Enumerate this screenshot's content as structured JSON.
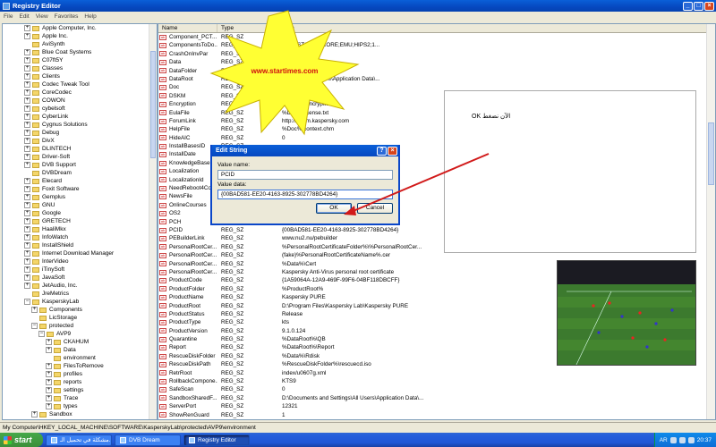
{
  "window": {
    "title": "Registry Editor"
  },
  "menu": [
    "File",
    "Edit",
    "View",
    "Favorites",
    "Help"
  ],
  "tree": [
    {
      "label": "Apple Computer, Inc.",
      "depth": 2,
      "exp": "+"
    },
    {
      "label": "Apple Inc.",
      "depth": 2,
      "exp": "+"
    },
    {
      "label": "AviSynth",
      "depth": 2,
      "exp": ""
    },
    {
      "label": "Blue Coat Systems",
      "depth": 2,
      "exp": "+"
    },
    {
      "label": "C07ft5Y",
      "depth": 2,
      "exp": "+"
    },
    {
      "label": "Classes",
      "depth": 2,
      "exp": "+"
    },
    {
      "label": "Clients",
      "depth": 2,
      "exp": "+"
    },
    {
      "label": "Codec Tweak Tool",
      "depth": 2,
      "exp": "+"
    },
    {
      "label": "CoreCodec",
      "depth": 2,
      "exp": "+"
    },
    {
      "label": "COWON",
      "depth": 2,
      "exp": "+"
    },
    {
      "label": "cybelsoft",
      "depth": 2,
      "exp": "+"
    },
    {
      "label": "CyberLink",
      "depth": 2,
      "exp": "+"
    },
    {
      "label": "Cygnus Solutions",
      "depth": 2,
      "exp": "+"
    },
    {
      "label": "Debug",
      "depth": 2,
      "exp": "+"
    },
    {
      "label": "DivX",
      "depth": 2,
      "exp": "+"
    },
    {
      "label": "DLINTECH",
      "depth": 2,
      "exp": "+"
    },
    {
      "label": "Driver-Soft",
      "depth": 2,
      "exp": "+"
    },
    {
      "label": "DVB Support",
      "depth": 2,
      "exp": "+"
    },
    {
      "label": "DVBDream",
      "depth": 2,
      "exp": ""
    },
    {
      "label": "Elecard",
      "depth": 2,
      "exp": "+"
    },
    {
      "label": "Foxit Software",
      "depth": 2,
      "exp": "+"
    },
    {
      "label": "Gemplus",
      "depth": 2,
      "exp": "+"
    },
    {
      "label": "GNU",
      "depth": 2,
      "exp": "+"
    },
    {
      "label": "Google",
      "depth": 2,
      "exp": "+"
    },
    {
      "label": "GRETECH",
      "depth": 2,
      "exp": "+"
    },
    {
      "label": "HaaliMkx",
      "depth": 2,
      "exp": "+"
    },
    {
      "label": "InfoWatch",
      "depth": 2,
      "exp": "+"
    },
    {
      "label": "InstallShield",
      "depth": 2,
      "exp": "+"
    },
    {
      "label": "Internet Download Manager",
      "depth": 2,
      "exp": "+"
    },
    {
      "label": "InterVideo",
      "depth": 2,
      "exp": "+"
    },
    {
      "label": "iTinySoft",
      "depth": 2,
      "exp": "+"
    },
    {
      "label": "JavaSoft",
      "depth": 2,
      "exp": "+"
    },
    {
      "label": "JetAudio, Inc.",
      "depth": 2,
      "exp": "+"
    },
    {
      "label": "JreMetrics",
      "depth": 2,
      "exp": ""
    },
    {
      "label": "KasperskyLab",
      "depth": 2,
      "exp": "-"
    },
    {
      "label": "Components",
      "depth": 3,
      "exp": "+"
    },
    {
      "label": "LicStorage",
      "depth": 3,
      "exp": ""
    },
    {
      "label": "protected",
      "depth": 3,
      "exp": "-"
    },
    {
      "label": "AVP9",
      "depth": 4,
      "exp": "-"
    },
    {
      "label": "CKAHUM",
      "depth": 5,
      "exp": "+"
    },
    {
      "label": "Data",
      "depth": 5,
      "exp": "+"
    },
    {
      "label": "environment",
      "depth": 5,
      "exp": ""
    },
    {
      "label": "FilesToRemove",
      "depth": 5,
      "exp": "+"
    },
    {
      "label": "profiles",
      "depth": 5,
      "exp": "+"
    },
    {
      "label": "reports",
      "depth": 5,
      "exp": "+"
    },
    {
      "label": "settings",
      "depth": 5,
      "exp": "+"
    },
    {
      "label": "Trace",
      "depth": 5,
      "exp": "+"
    },
    {
      "label": "types",
      "depth": 5,
      "exp": "+"
    },
    {
      "label": "Sandbox",
      "depth": 3,
      "exp": "+"
    },
    {
      "label": "SetupFolders",
      "depth": 3,
      "exp": ""
    }
  ],
  "list": {
    "headers": [
      "Name",
      "Type",
      "Data"
    ],
    "rows": [
      {
        "name": "Component_PCT...",
        "type": "REG_SZ",
        "data": "1"
      },
      {
        "name": "ComponentsToDo...",
        "type": "REG_SZ",
        "data": "AV;BLST2;BSS;CORE;EMU;HIPS2;1..."
      },
      {
        "name": "CrashOnInvPar",
        "type": "REG_SZ",
        "data": ""
      },
      {
        "name": "Data",
        "type": "REG_SZ",
        "data": ""
      },
      {
        "name": "DataFolder",
        "type": "REG_SZ",
        "data": ""
      },
      {
        "name": "DataRoot",
        "type": "REG_SZ",
        "data": "...Settings\\All Users\\Application Data\\..."
      },
      {
        "name": "Doc",
        "type": "REG_SZ",
        "data": ""
      },
      {
        "name": "DSKM",
        "type": "REG_SZ",
        "data": "%Data%\\dskm"
      },
      {
        "name": "Encryption",
        "type": "REG_SZ",
        "data": "%Data%\\Encryption"
      },
      {
        "name": "EulaFile",
        "type": "REG_SZ",
        "data": "%Doc%\\license.txt"
      },
      {
        "name": "ForumLink",
        "type": "REG_SZ",
        "data": "http://forum.kaspersky.com"
      },
      {
        "name": "HelpFile",
        "type": "REG_SZ",
        "data": "%Doc%\\context.chm"
      },
      {
        "name": "HideAIC",
        "type": "REG_SZ",
        "data": "0"
      },
      {
        "name": "InstallBasesID",
        "type": "REG_SZ",
        "data": ""
      },
      {
        "name": "InstallDate",
        "type": "REG_SZ",
        "data": ""
      },
      {
        "name": "KnowledgeBaseL...",
        "type": "REG_SZ",
        "data": ""
      },
      {
        "name": "Localization",
        "type": "REG_SZ",
        "data": ""
      },
      {
        "name": "LocalizationId",
        "type": "REG_SZ",
        "data": ""
      },
      {
        "name": "NeedReboot4Co...",
        "type": "REG_SZ",
        "data": ""
      },
      {
        "name": "NewsFile",
        "type": "REG_SZ",
        "data": ""
      },
      {
        "name": "OnlineCourses",
        "type": "REG_SZ",
        "data": "...ses"
      },
      {
        "name": "OS2",
        "type": "REG_SZ",
        "data": ""
      },
      {
        "name": "PCH",
        "type": "REG_SZ",
        "data": ""
      },
      {
        "name": "PCID",
        "type": "REG_SZ",
        "data": "{00BAD581-EE20-4163-8925-302778BD4264}"
      },
      {
        "name": "PEBuilderLink",
        "type": "REG_SZ",
        "data": "www.nu2.nu/pebuilder"
      },
      {
        "name": "PersonalRootCer...",
        "type": "REG_SZ",
        "data": "%PersonalRootCertificateFolder%\\%PersonalRootCer..."
      },
      {
        "name": "PersonalRootCer...",
        "type": "REG_SZ",
        "data": "(fake)%PersonalRootCertificateName%.cer"
      },
      {
        "name": "PersonalRootCer...",
        "type": "REG_SZ",
        "data": "%Data%\\Cert"
      },
      {
        "name": "PersonalRootCer...",
        "type": "REG_SZ",
        "data": "Kaspersky Anti-Virus personal root certificate"
      },
      {
        "name": "ProductCode",
        "type": "REG_SZ",
        "data": "{1A59064A-12A9-469F-99F6-04BF118DBCFF}"
      },
      {
        "name": "ProductFolder",
        "type": "REG_SZ",
        "data": "%ProductRoot%"
      },
      {
        "name": "ProductName",
        "type": "REG_SZ",
        "data": "Kaspersky PURE"
      },
      {
        "name": "ProductRoot",
        "type": "REG_SZ",
        "data": "D:\\Program Files\\Kaspersky Lab\\Kaspersky PURE"
      },
      {
        "name": "ProductStatus",
        "type": "REG_SZ",
        "data": "Release"
      },
      {
        "name": "ProductType",
        "type": "REG_SZ",
        "data": "kts"
      },
      {
        "name": "ProductVersion",
        "type": "REG_SZ",
        "data": "9.1.0.124"
      },
      {
        "name": "Quarantine",
        "type": "REG_SZ",
        "data": "%DataRoot%\\QB"
      },
      {
        "name": "Report",
        "type": "REG_SZ",
        "data": "%DataRoot%\\Report"
      },
      {
        "name": "RescueDiskFolder",
        "type": "REG_SZ",
        "data": "%Data%\\Rdisk"
      },
      {
        "name": "RescueDiskPath",
        "type": "REG_SZ",
        "data": "%RescueDiskFolder%\\rescuecd.iso"
      },
      {
        "name": "RetrRoot",
        "type": "REG_SZ",
        "data": "index/u0607g.xml"
      },
      {
        "name": "RollbackCompone...",
        "type": "REG_SZ",
        "data": "KTS9"
      },
      {
        "name": "SafeScan",
        "type": "REG_SZ",
        "data": "0"
      },
      {
        "name": "SandboxSharedF...",
        "type": "REG_SZ",
        "data": "D:\\Documents and Settings\\All Users\\Application Data\\..."
      },
      {
        "name": "ServerPort",
        "type": "REG_SZ",
        "data": "12321"
      },
      {
        "name": "ShowRenGuard",
        "type": "REG_SZ",
        "data": "1"
      }
    ]
  },
  "statusbar": "My Computer\\HKEY_LOCAL_MACHINE\\SOFTWARE\\KasperskyLab\\protected\\AVP9\\environment",
  "dialog": {
    "title": "Edit String",
    "name_label": "Value name:",
    "name_value": "PCID",
    "data_label": "Value data:",
    "data_value": "{00BAD581-EE20-4163-8925-302778BD4264}",
    "ok": "OK",
    "cancel": "Cancel"
  },
  "starburst_text": "www.startimes.com",
  "note_text": "الآن نضغط OK",
  "taskbar": {
    "start": "start",
    "tasks": [
      {
        "label": "مشكلة في تحميل الـ...",
        "active": false
      },
      {
        "label": "DVB Dream",
        "active": false
      },
      {
        "label": "Registry Editor",
        "active": true
      }
    ],
    "lang": "AR",
    "clock": "20:37"
  },
  "colors": {
    "accent": "#0a5fd8",
    "starburst": "#ffff33",
    "arrow": "#d11a1a",
    "url_text": "#d01010"
  }
}
